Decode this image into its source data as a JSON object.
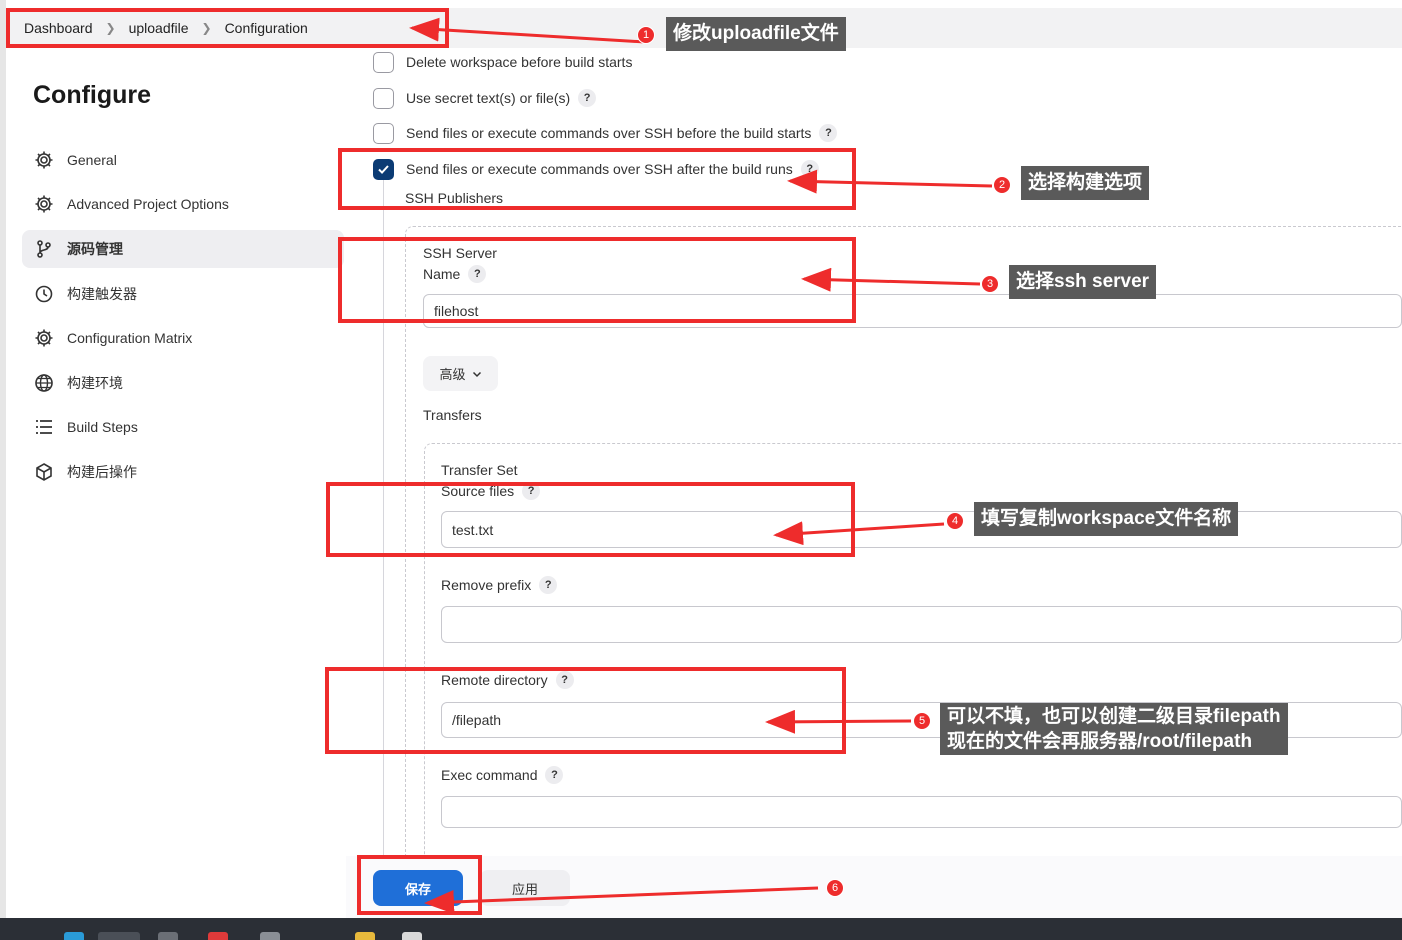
{
  "breadcrumb": [
    "Dashboard",
    "uploadfile",
    "Configuration"
  ],
  "sidebar": {
    "title": "Configure",
    "items": [
      {
        "label": "General",
        "icon": "gear-icon"
      },
      {
        "label": "Advanced Project Options",
        "icon": "gear-icon"
      },
      {
        "label": "源码管理",
        "icon": "branch-icon"
      },
      {
        "label": "构建触发器",
        "icon": "clock-icon"
      },
      {
        "label": "Configuration Matrix",
        "icon": "gear-icon"
      },
      {
        "label": "构建环境",
        "icon": "globe-icon"
      },
      {
        "label": "Build Steps",
        "icon": "list-icon"
      },
      {
        "label": "构建后操作",
        "icon": "cube-icon"
      }
    ]
  },
  "options": [
    {
      "label": "Delete workspace before build starts",
      "checked": false
    },
    {
      "label": "Use secret text(s) or file(s)",
      "checked": false
    },
    {
      "label": "Send files or execute commands over SSH before the build starts",
      "checked": false
    },
    {
      "label": "Send files or execute commands over SSH after the build runs",
      "checked": true
    }
  ],
  "ssh": {
    "publishers_label": "SSH Publishers",
    "server_label": "SSH Server",
    "name_label": "Name",
    "name_value": "filehost",
    "advanced_label": "高级",
    "transfers_label": "Transfers",
    "transfer_set_label": "Transfer Set",
    "source_files_label": "Source files",
    "source_files_value": "test.txt",
    "remove_prefix_label": "Remove prefix",
    "remove_prefix_value": "",
    "remote_dir_label": "Remote directory",
    "remote_dir_value": "/filepath",
    "exec_label": "Exec command",
    "exec_value": ""
  },
  "buttons": {
    "save": "保存",
    "apply": "应用"
  },
  "help_glyph": "?",
  "annotations": {
    "n1": "1",
    "c1": "修改uploadfile文件",
    "n2": "2",
    "c2": "选择构建选项",
    "n3": "3",
    "c3": "选择ssh server",
    "n4": "4",
    "c4": "填写复制workspace文件名称",
    "n5": "5",
    "c5a": "可以不填，也可以创建二级目录filepath",
    "c5b": "现在的文件会再服务器/root/filepath",
    "n6": "6"
  },
  "colors": {
    "annotation_red": "#ee2c2c",
    "primary_button": "#1f6fd8",
    "checked_box": "#0b3b74"
  }
}
